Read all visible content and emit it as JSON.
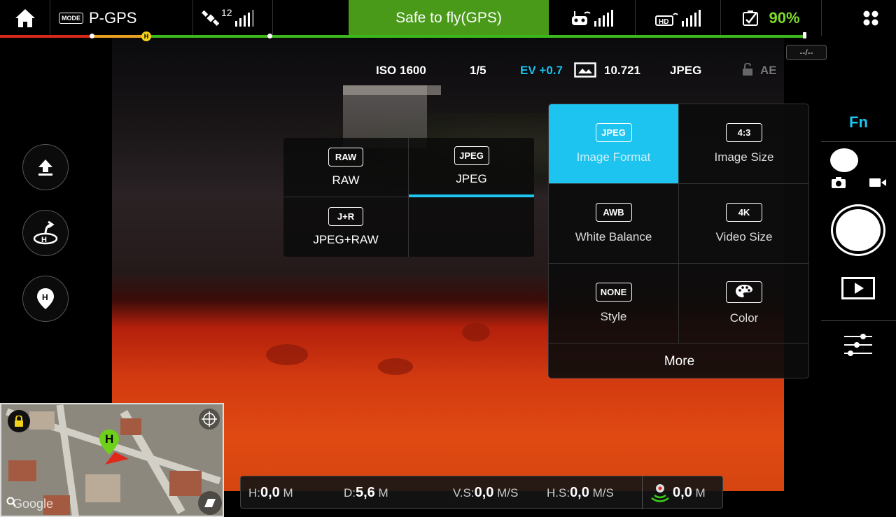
{
  "top_bar": {
    "mode_badge": "MODE",
    "mode": "P-GPS",
    "satellites": "12",
    "status": "Safe to fly(GPS)",
    "battery": "90%"
  },
  "distance_chip": "--/--",
  "camera_params": {
    "iso": "ISO 1600",
    "shutter": "1/5",
    "ev": "EV +0.7",
    "storage": "10.721",
    "format": "JPEG",
    "ae": "AE"
  },
  "format_submenu": [
    {
      "badge": "RAW",
      "label": "RAW",
      "selected": false
    },
    {
      "badge": "JPEG",
      "label": "JPEG",
      "selected": true
    },
    {
      "badge": "J+R",
      "label": "JPEG+RAW",
      "selected": false
    }
  ],
  "settings_menu": {
    "items": [
      {
        "badge": "JPEG",
        "label": "Image Format",
        "active": true
      },
      {
        "badge": "4:3",
        "label": "Image Size",
        "active": false
      },
      {
        "badge": "AWB",
        "label": "White Balance",
        "active": false
      },
      {
        "badge": "4K",
        "label": "Video Size",
        "active": false
      },
      {
        "badge": "NONE",
        "label": "Style",
        "active": false
      },
      {
        "badge": "",
        "label": "Color",
        "active": false
      }
    ],
    "more": "More"
  },
  "right_rail": {
    "fn": "Fn"
  },
  "map": {
    "home_marker": "H",
    "watermark": "Google"
  },
  "telemetry": {
    "h_label": "H:",
    "h_value": "0,0",
    "h_unit": "M",
    "d_label": "D:",
    "d_value": "5,6",
    "d_unit": "M",
    "vs_label": "V.S:",
    "vs_value": "0,0",
    "vs_unit": "M/S",
    "hs_label": "H.S:",
    "hs_value": "0,0",
    "hs_unit": "M/S",
    "obstacle_value": "0,0",
    "obstacle_unit": "M"
  },
  "colors": {
    "accent": "#1cc4ef",
    "status_ok": "#4a9a1a",
    "battery": "#7cdc28",
    "home": "#f2d11a"
  }
}
